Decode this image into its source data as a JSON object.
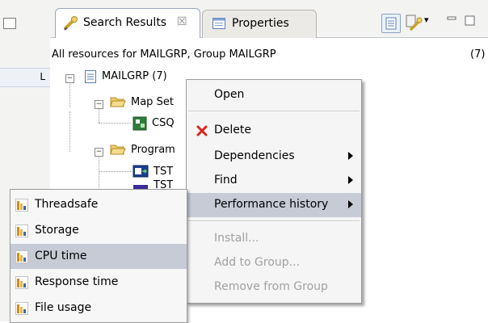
{
  "tabs": {
    "search_results": "Search Results",
    "search_close": "☒",
    "properties": "Properties"
  },
  "toolbar": {
    "dropdown_arrow": "▾"
  },
  "left_panel": {
    "header_label": "L"
  },
  "view": {
    "description": "All resources for MAILGRP, Group MAILGRP",
    "count": "(7)"
  },
  "tree": {
    "root_label": "MAILGRP (7)",
    "mapset_label": "Map Set",
    "mapset_child": "CSQ",
    "program_label": "Program",
    "program_child_1": "TST",
    "program_child_2": "TST"
  },
  "context_menu": {
    "items": [
      {
        "label": "Open"
      },
      {
        "label": "Delete"
      },
      {
        "label": "Dependencies"
      },
      {
        "label": "Find"
      },
      {
        "label": "Performance history"
      },
      {
        "label": "Install..."
      },
      {
        "label": "Add to Group..."
      },
      {
        "label": "Remove from Group"
      }
    ]
  },
  "submenu": {
    "items": [
      {
        "label": "Threadsafe"
      },
      {
        "label": "Storage"
      },
      {
        "label": "CPU time"
      },
      {
        "label": "Response time"
      },
      {
        "label": "File usage"
      }
    ]
  },
  "colors": {
    "menu_highlight": "#c7cbd6",
    "delete_icon": "#d9281c",
    "folder": "#e8b84a",
    "disabled_text": "#a0a0a0"
  }
}
